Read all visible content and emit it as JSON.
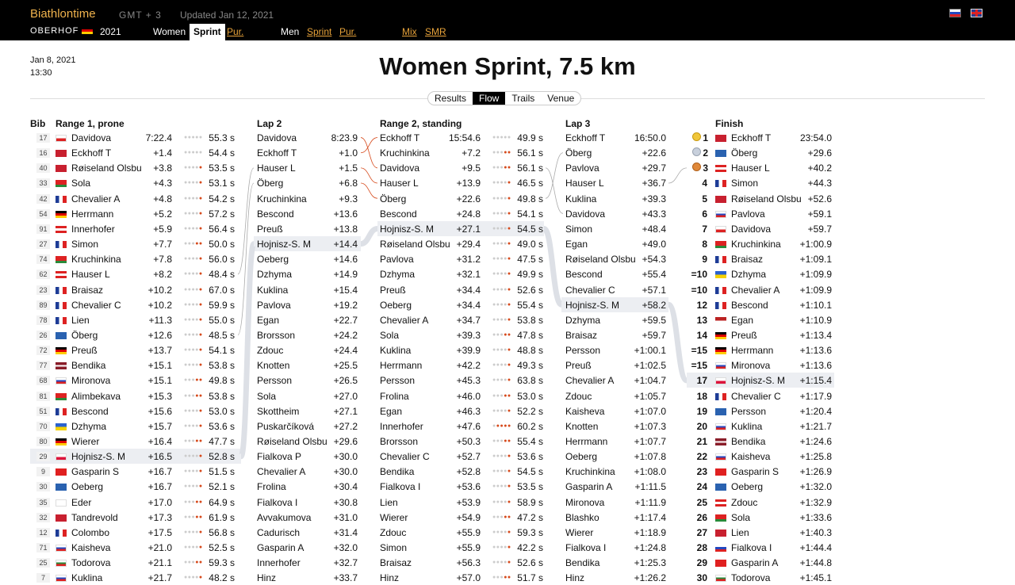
{
  "topbar": {
    "brand": "Biathlontime",
    "gmt": "GMT + 3",
    "updated": "Updated Jan 12, 2021",
    "place": "OBERHOF",
    "year": "2021",
    "tabs": [
      "Women",
      "Sprint",
      "Pur.",
      "Men",
      "Sprint",
      "Pur.",
      "Mix",
      "SMR"
    ]
  },
  "event": {
    "date": "Jan 8, 2021",
    "time": "13:30",
    "title": "Women Sprint, 7.5 km"
  },
  "view_tabs": [
    "Results",
    "Flow",
    "Trails",
    "Venue"
  ],
  "headers": {
    "bib": "Bib",
    "range1": "Range 1, prone",
    "lap2": "Lap 2",
    "range2": "Range 2, standing",
    "lap3": "Lap 3",
    "finish": "Finish"
  },
  "colors": {
    "miss": "#d64a1c",
    "hit": "#cccccc",
    "highlight": "#eceef2"
  },
  "range1": [
    [
      "17",
      "cz",
      "Davidova",
      "7:22.4",
      "00000",
      "55.3 s"
    ],
    [
      "16",
      "no",
      "Eckhoff T",
      "+1.4",
      "00000",
      "54.4 s"
    ],
    [
      "40",
      "no",
      "Røiseland Olsbu",
      "+3.8",
      "00001",
      "53.5 s"
    ],
    [
      "33",
      "by",
      "Sola",
      "+4.3",
      "00001",
      "53.1 s"
    ],
    [
      "42",
      "fr",
      "Chevalier A",
      "+4.8",
      "00001",
      "54.2 s"
    ],
    [
      "54",
      "de",
      "Herrmann",
      "+5.2",
      "00001",
      "57.2 s"
    ],
    [
      "91",
      "at",
      "Innerhofer",
      "+5.9",
      "00001",
      "56.4 s"
    ],
    [
      "27",
      "fr",
      "Simon",
      "+7.7",
      "00011",
      "50.0 s"
    ],
    [
      "74",
      "by",
      "Kruchinkina",
      "+7.8",
      "00001",
      "56.0 s"
    ],
    [
      "62",
      "at",
      "Hauser L",
      "+8.2",
      "00001",
      "48.4 s"
    ],
    [
      "23",
      "fr",
      "Braisaz",
      "+10.2",
      "00001",
      "67.0 s"
    ],
    [
      "89",
      "fr",
      "Chevalier C",
      "+10.2",
      "00001",
      "59.9 s"
    ],
    [
      "78",
      "fr",
      "Lien",
      "+11.3",
      "00001",
      "55.0 s"
    ],
    [
      "26",
      "se",
      "Öberg",
      "+12.6",
      "00001",
      "48.5 s"
    ],
    [
      "72",
      "de",
      "Preuß",
      "+13.7",
      "00001",
      "54.1 s"
    ],
    [
      "77",
      "lv",
      "Bendika",
      "+15.1",
      "00001",
      "53.8 s"
    ],
    [
      "68",
      "ru",
      "Mironova",
      "+15.1",
      "00011",
      "49.8 s"
    ],
    [
      "81",
      "by",
      "Alimbekava",
      "+15.3",
      "00011",
      "53.8 s"
    ],
    [
      "51",
      "fr",
      "Bescond",
      "+15.6",
      "00001",
      "53.0 s"
    ],
    [
      "70",
      "ua",
      "Dzhyma",
      "+15.7",
      "00001",
      "53.6 s"
    ],
    [
      "80",
      "de",
      "Wierer",
      "+16.4",
      "00011",
      "47.7 s"
    ],
    [
      "29",
      "pl",
      "Hojnisz-S. M",
      "+16.5",
      "00001",
      "52.8 s"
    ],
    [
      "9",
      "ch",
      "Gasparin S",
      "+16.7",
      "00001",
      "51.5 s"
    ],
    [
      "30",
      "se",
      "Oeberg",
      "+16.7",
      "00001",
      "52.1 s"
    ],
    [
      "35",
      "fi",
      "Eder",
      "+17.0",
      "00011",
      "64.9 s"
    ],
    [
      "32",
      "no",
      "Tandrevold",
      "+17.3",
      "00011",
      "61.9 s"
    ],
    [
      "12",
      "fr",
      "Colombo",
      "+17.5",
      "00001",
      "56.8 s"
    ],
    [
      "71",
      "ru",
      "Kaisheva",
      "+21.0",
      "00001",
      "52.5 s"
    ],
    [
      "25",
      "bg",
      "Todorova",
      "+21.1",
      "00011",
      "59.3 s"
    ],
    [
      "7",
      "ru",
      "Kuklina",
      "+21.7",
      "00001",
      "48.2 s"
    ]
  ],
  "lap2": [
    [
      "Davidova",
      "8:23.9"
    ],
    [
      "Eckhoff T",
      "+1.0"
    ],
    [
      "Hauser L",
      "+1.5"
    ],
    [
      "Öberg",
      "+6.8"
    ],
    [
      "Kruchinkina",
      "+9.3"
    ],
    [
      "Bescond",
      "+13.6"
    ],
    [
      "Preuß",
      "+13.8"
    ],
    [
      "Hojnisz-S. M",
      "+14.4"
    ],
    [
      "Oeberg",
      "+14.6"
    ],
    [
      "Dzhyma",
      "+14.9"
    ],
    [
      "Kuklina",
      "+15.4"
    ],
    [
      "Pavlova",
      "+19.2"
    ],
    [
      "Egan",
      "+22.7"
    ],
    [
      "Brorsson",
      "+24.2"
    ],
    [
      "Zdouc",
      "+24.4"
    ],
    [
      "Knotten",
      "+25.5"
    ],
    [
      "Persson",
      "+26.5"
    ],
    [
      "Sola",
      "+27.0"
    ],
    [
      "Skottheim",
      "+27.1"
    ],
    [
      "Puskarčíková",
      "+27.2"
    ],
    [
      "Røiseland Olsbu",
      "+29.6"
    ],
    [
      "Fialkova P",
      "+30.0"
    ],
    [
      "Chevalier A",
      "+30.0"
    ],
    [
      "Frolina",
      "+30.4"
    ],
    [
      "Fialkova I",
      "+30.8"
    ],
    [
      "Avvakumova",
      "+31.0"
    ],
    [
      "Cadurisch",
      "+31.4"
    ],
    [
      "Gasparin A",
      "+32.0"
    ],
    [
      "Innerhofer",
      "+32.7"
    ],
    [
      "Hinz",
      "+33.7"
    ]
  ],
  "range2": [
    [
      "Eckhoff T",
      "15:54.6",
      "00000",
      "49.9 s"
    ],
    [
      "Kruchinkina",
      "+7.2",
      "00011",
      "56.1 s"
    ],
    [
      "Davidova",
      "+9.5",
      "00011",
      "56.1 s"
    ],
    [
      "Hauser L",
      "+13.9",
      "00001",
      "46.5 s"
    ],
    [
      "Öberg",
      "+22.6",
      "00001",
      "49.8 s"
    ],
    [
      "Bescond",
      "+24.8",
      "00001",
      "54.1 s"
    ],
    [
      "Hojnisz-S. M",
      "+27.1",
      "00001",
      "54.5 s"
    ],
    [
      "Røiseland Olsbu",
      "+29.4",
      "00001",
      "49.0 s"
    ],
    [
      "Pavlova",
      "+31.2",
      "00001",
      "47.5 s"
    ],
    [
      "Dzhyma",
      "+32.1",
      "00001",
      "49.9 s"
    ],
    [
      "Preuß",
      "+34.4",
      "00001",
      "52.6 s"
    ],
    [
      "Oeberg",
      "+34.4",
      "00001",
      "55.4 s"
    ],
    [
      "Chevalier A",
      "+34.7",
      "00001",
      "53.8 s"
    ],
    [
      "Sola",
      "+39.3",
      "00011",
      "47.8 s"
    ],
    [
      "Kuklina",
      "+39.9",
      "00001",
      "48.8 s"
    ],
    [
      "Herrmann",
      "+42.2",
      "00001",
      "49.3 s"
    ],
    [
      "Persson",
      "+45.3",
      "00001",
      "63.8 s"
    ],
    [
      "Frolina",
      "+46.0",
      "00011",
      "53.0 s"
    ],
    [
      "Egan",
      "+46.3",
      "00001",
      "52.2 s"
    ],
    [
      "Innerhofer",
      "+47.6",
      "01111",
      "60.2 s"
    ],
    [
      "Brorsson",
      "+50.3",
      "00011",
      "55.4 s"
    ],
    [
      "Chevalier C",
      "+52.7",
      "00001",
      "53.6 s"
    ],
    [
      "Bendika",
      "+52.8",
      "00001",
      "54.5 s"
    ],
    [
      "Fialkova I",
      "+53.6",
      "00001",
      "53.5 s"
    ],
    [
      "Lien",
      "+53.9",
      "00001",
      "58.9 s"
    ],
    [
      "Wierer",
      "+54.9",
      "00011",
      "47.2 s"
    ],
    [
      "Zdouc",
      "+55.9",
      "00001",
      "59.3 s"
    ],
    [
      "Simon",
      "+55.9",
      "00001",
      "42.2 s"
    ],
    [
      "Braisaz",
      "+56.3",
      "00001",
      "52.6 s"
    ],
    [
      "Hinz",
      "+57.0",
      "00011",
      "51.7 s"
    ]
  ],
  "lap3": [
    [
      "Eckhoff T",
      "16:50.0"
    ],
    [
      "Öberg",
      "+22.6"
    ],
    [
      "Pavlova",
      "+29.7"
    ],
    [
      "Hauser L",
      "+36.7"
    ],
    [
      "Kuklina",
      "+39.3"
    ],
    [
      "Davidova",
      "+43.3"
    ],
    [
      "Simon",
      "+48.4"
    ],
    [
      "Egan",
      "+49.0"
    ],
    [
      "Røiseland Olsbu",
      "+54.3"
    ],
    [
      "Bescond",
      "+55.4"
    ],
    [
      "Chevalier C",
      "+57.1"
    ],
    [
      "Hojnisz-S. M",
      "+58.2"
    ],
    [
      "Dzhyma",
      "+59.5"
    ],
    [
      "Braisaz",
      "+59.7"
    ],
    [
      "Persson",
      "+1:00.1"
    ],
    [
      "Preuß",
      "+1:02.5"
    ],
    [
      "Chevalier A",
      "+1:04.7"
    ],
    [
      "Zdouc",
      "+1:05.7"
    ],
    [
      "Kaisheva",
      "+1:07.0"
    ],
    [
      "Knotten",
      "+1:07.3"
    ],
    [
      "Herrmann",
      "+1:07.7"
    ],
    [
      "Oeberg",
      "+1:07.8"
    ],
    [
      "Kruchinkina",
      "+1:08.0"
    ],
    [
      "Gasparin A",
      "+1:11.5"
    ],
    [
      "Mironova",
      "+1:11.9"
    ],
    [
      "Blashko",
      "+1:17.4"
    ],
    [
      "Wierer",
      "+1:18.9"
    ],
    [
      "Fialkova I",
      "+1:24.8"
    ],
    [
      "Bendika",
      "+1:25.3"
    ],
    [
      "Hinz",
      "+1:26.2"
    ]
  ],
  "finish": [
    [
      "1",
      "no",
      "Eckhoff T",
      "23:54.0"
    ],
    [
      "2",
      "se",
      "Öberg",
      "+29.6"
    ],
    [
      "3",
      "at",
      "Hauser L",
      "+40.2"
    ],
    [
      "4",
      "fr",
      "Simon",
      "+44.3"
    ],
    [
      "5",
      "no",
      "Røiseland Olsbu",
      "+52.6"
    ],
    [
      "6",
      "ru",
      "Pavlova",
      "+59.1"
    ],
    [
      "7",
      "cz",
      "Davidova",
      "+59.7"
    ],
    [
      "8",
      "by",
      "Kruchinkina",
      "+1:00.9"
    ],
    [
      "9",
      "fr",
      "Braisaz",
      "+1:09.1"
    ],
    [
      "=10",
      "ua",
      "Dzhyma",
      "+1:09.9"
    ],
    [
      "=10",
      "fr",
      "Chevalier A",
      "+1:09.9"
    ],
    [
      "12",
      "fr",
      "Bescond",
      "+1:10.1"
    ],
    [
      "13",
      "us",
      "Egan",
      "+1:10.9"
    ],
    [
      "14",
      "de",
      "Preuß",
      "+1:13.4"
    ],
    [
      "=15",
      "de",
      "Herrmann",
      "+1:13.6"
    ],
    [
      "=15",
      "ru",
      "Mironova",
      "+1:13.6"
    ],
    [
      "17",
      "pl",
      "Hojnisz-S. M",
      "+1:15.4"
    ],
    [
      "18",
      "fr",
      "Chevalier C",
      "+1:17.9"
    ],
    [
      "19",
      "se",
      "Persson",
      "+1:20.4"
    ],
    [
      "20",
      "ru",
      "Kuklina",
      "+1:21.7"
    ],
    [
      "21",
      "lv",
      "Bendika",
      "+1:24.6"
    ],
    [
      "22",
      "ru",
      "Kaisheva",
      "+1:25.8"
    ],
    [
      "23",
      "ch",
      "Gasparin S",
      "+1:26.9"
    ],
    [
      "24",
      "se",
      "Oeberg",
      "+1:32.0"
    ],
    [
      "25",
      "at",
      "Zdouc",
      "+1:32.9"
    ],
    [
      "26",
      "by",
      "Sola",
      "+1:33.6"
    ],
    [
      "27",
      "no",
      "Lien",
      "+1:40.3"
    ],
    [
      "28",
      "sk",
      "Fialkova I",
      "+1:44.4"
    ],
    [
      "29",
      "ch",
      "Gasparin A",
      "+1:44.8"
    ],
    [
      "30",
      "bg",
      "Todorova",
      "+1:45.1"
    ]
  ]
}
